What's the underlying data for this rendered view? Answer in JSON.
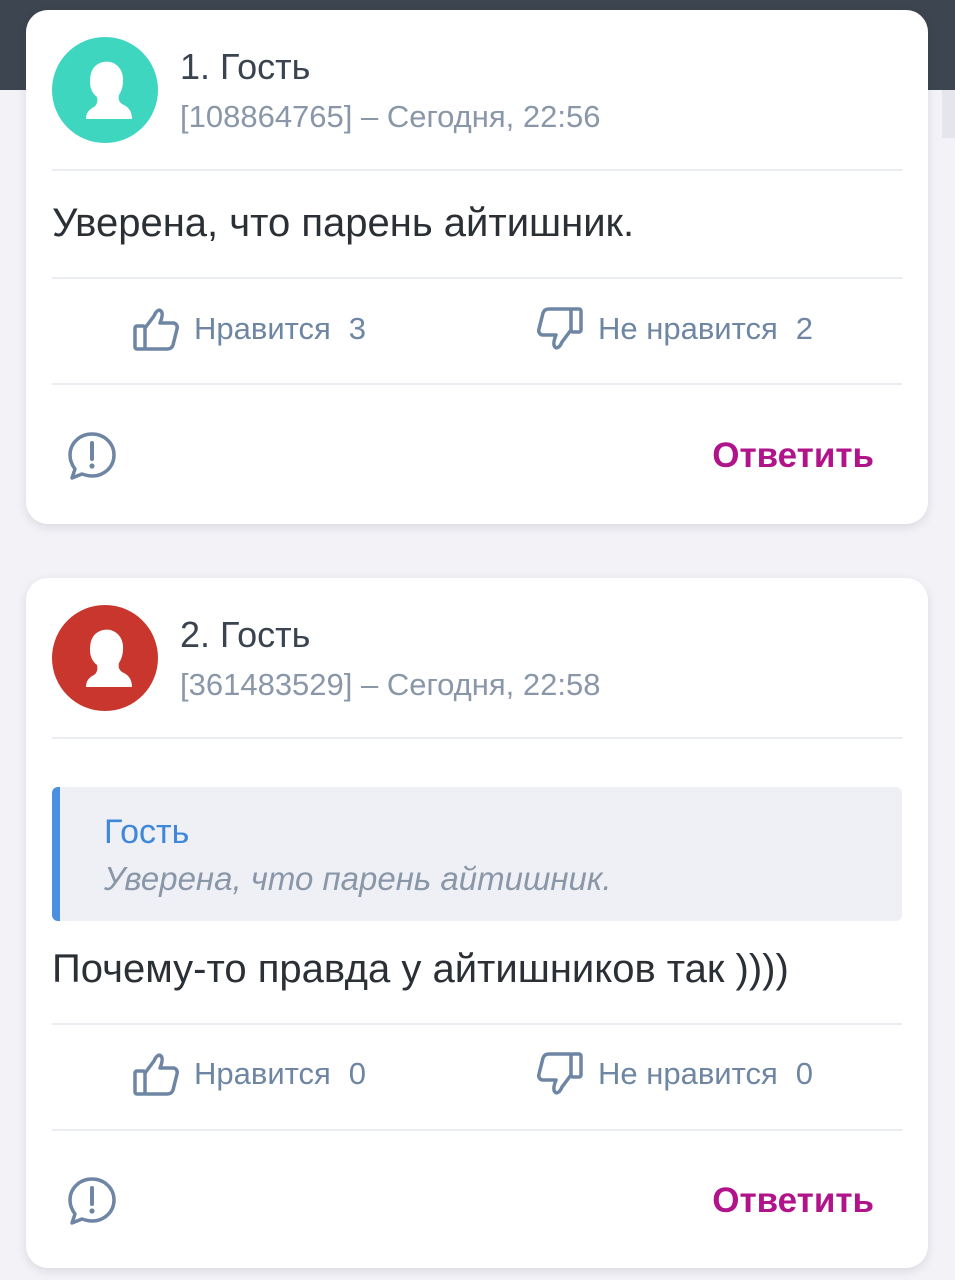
{
  "colors": {
    "accent_reply": "#b0138a",
    "avatar_1": "#3fd6c0",
    "avatar_2": "#c9362e",
    "quote_bar": "#4a8fe0",
    "action_gray": "#6e86a3"
  },
  "comments": [
    {
      "author": "1. Гость",
      "meta": "[108864765] – Сегодня, 22:56",
      "text": "Уверена, что парень айтишник.",
      "like_label": "Нравится",
      "like_count": "3",
      "dislike_label": "Не нравится",
      "dislike_count": "2",
      "reply_label": "Ответить",
      "icons": {
        "avatar": "user-silhouette-icon",
        "like": "thumbs-up-icon",
        "dislike": "thumbs-down-icon",
        "report": "report-icon"
      }
    },
    {
      "author": "2. Гость",
      "meta": "[361483529] – Сегодня, 22:58",
      "quote": {
        "author": "Гость",
        "text": "Уверена, что парень айтишник."
      },
      "text": "Почему-то правда у айтишников так ))))",
      "like_label": "Нравится",
      "like_count": "0",
      "dislike_label": "Не нравится",
      "dislike_count": "0",
      "reply_label": "Ответить",
      "icons": {
        "avatar": "user-silhouette-icon",
        "like": "thumbs-up-icon",
        "dislike": "thumbs-down-icon",
        "report": "report-icon"
      }
    }
  ]
}
